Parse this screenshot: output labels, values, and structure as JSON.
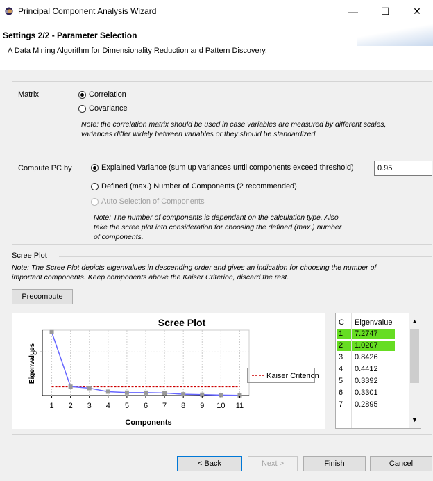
{
  "window": {
    "title": "Principal Component Analysis Wizard",
    "minimize": "—",
    "maximize": "☐",
    "close": "✕"
  },
  "header": {
    "title": "Settings 2/2 - Parameter Selection",
    "description": "A Data Mining Algorithm for Dimensionality Reduction and Pattern Discovery."
  },
  "matrix": {
    "label": "Matrix",
    "options": [
      "Correlation",
      "Covariance"
    ],
    "selected": "Correlation",
    "note_line1": "Note: the correlation matrix should be used in case variables are measured by different scales,",
    "note_line2": "variances differ widely between variables or they should be standardized."
  },
  "compute": {
    "label": "Compute PC by",
    "option_variance": "Explained Variance (sum up variances until components exceed threshold)",
    "threshold": "0.95",
    "option_number": "Defined (max.) Number of Components (2 recommended)",
    "option_auto": "Auto Selection of Components",
    "selected": "Explained Variance",
    "note_line1": "Note: The number of components is dependant on the calculation type.  Also",
    "note_line2": "take the scree plot into consideration for choosing the defined (max.) number",
    "note_line3": "of components."
  },
  "scree": {
    "group_label": "Scree Plot",
    "note_line1": "Note: The Scree Plot depicts eigenvalues in descending order and gives an indication for choosing the number of",
    "note_line2": "important components. Keep components above the Kaiser Criterion, discard the rest.",
    "precompute_label": "Precompute",
    "legend_label": "Kaiser Criterion"
  },
  "table": {
    "headers": [
      "C",
      "Eigenvalue"
    ],
    "rows": [
      {
        "c": "1",
        "v": "7.2747",
        "hl": true
      },
      {
        "c": "2",
        "v": "1.0207",
        "hl": true
      },
      {
        "c": "3",
        "v": "0.8426",
        "hl": false
      },
      {
        "c": "4",
        "v": "0.4412",
        "hl": false
      },
      {
        "c": "5",
        "v": "0.3392",
        "hl": false
      },
      {
        "c": "6",
        "v": "0.3301",
        "hl": false
      },
      {
        "c": "7",
        "v": "0.2895",
        "hl": false
      }
    ]
  },
  "buttons": {
    "back": "< Back",
    "next": "Next >",
    "finish": "Finish",
    "cancel": "Cancel"
  },
  "chart_data": {
    "type": "line",
    "title": "Scree Plot",
    "xlabel": "Components",
    "ylabel": "Eigenvalues",
    "x": [
      1,
      2,
      3,
      4,
      5,
      6,
      7,
      8,
      9,
      10,
      11
    ],
    "series": [
      {
        "values": [
          7.2747,
          1.0207,
          0.8426,
          0.4412,
          0.3392,
          0.3301,
          0.2895,
          0.15,
          0.1,
          0.05,
          0.02
        ]
      },
      {
        "name": "Kaiser Criterion",
        "values": [
          1,
          1,
          1,
          1,
          1,
          1,
          1,
          1,
          1,
          1,
          1
        ]
      }
    ],
    "xlim": [
      0.5,
      11.5
    ],
    "ylim": [
      0,
      7.5
    ],
    "yticks": [
      5
    ],
    "grid": true,
    "legend": "right",
    "colors": {
      "eigen": "#6666ff",
      "marker": "#999999",
      "kaiser": "#cc0000"
    }
  }
}
